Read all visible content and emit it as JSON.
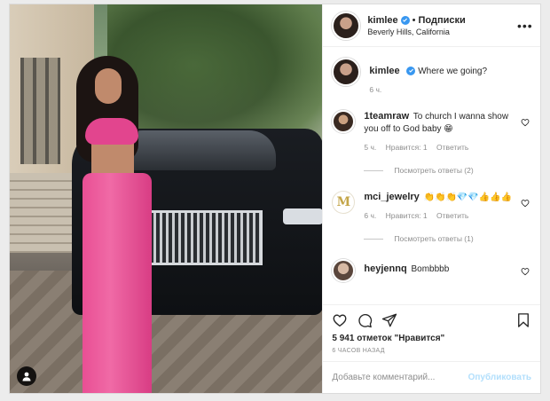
{
  "header": {
    "username": "kimlee",
    "separator": "•",
    "follow_label": "Подписки",
    "location": "Beverly Hills, California"
  },
  "caption": {
    "username": "kimlee",
    "text": "Where we going?",
    "time": "6 ч."
  },
  "comments": [
    {
      "username": "1teamraw",
      "text": "To church I wanna show you off to God baby 😁",
      "time": "5 ч.",
      "likes": "Нравится: 1",
      "reply": "Ответить",
      "view_replies": "Посмотреть ответы (2)"
    },
    {
      "username": "mci_jewelry",
      "text": "👏👏👏💎💎👍👍👍",
      "time": "6 ч.",
      "likes": "Нравится: 1",
      "reply": "Ответить",
      "view_replies": "Посмотреть ответы (1)"
    },
    {
      "username": "heyjennq",
      "text": "Bombbbb"
    }
  ],
  "stats": {
    "likes": "5 941 отметок \"Нравится\"",
    "posted": "6 ЧАСОВ НАЗАД"
  },
  "add_comment": {
    "placeholder": "Добавьте комментарий...",
    "publish": "Опубликовать"
  },
  "avatar_initial_mci": "M",
  "colors": {
    "verified": "#3897f0",
    "publish_disabled": "#b2dffc",
    "muted": "#8e8e8e"
  },
  "icons": [
    "verified-icon",
    "more-options-icon",
    "heart-icon",
    "comment-icon",
    "share-icon",
    "bookmark-icon",
    "user-tag-icon"
  ]
}
